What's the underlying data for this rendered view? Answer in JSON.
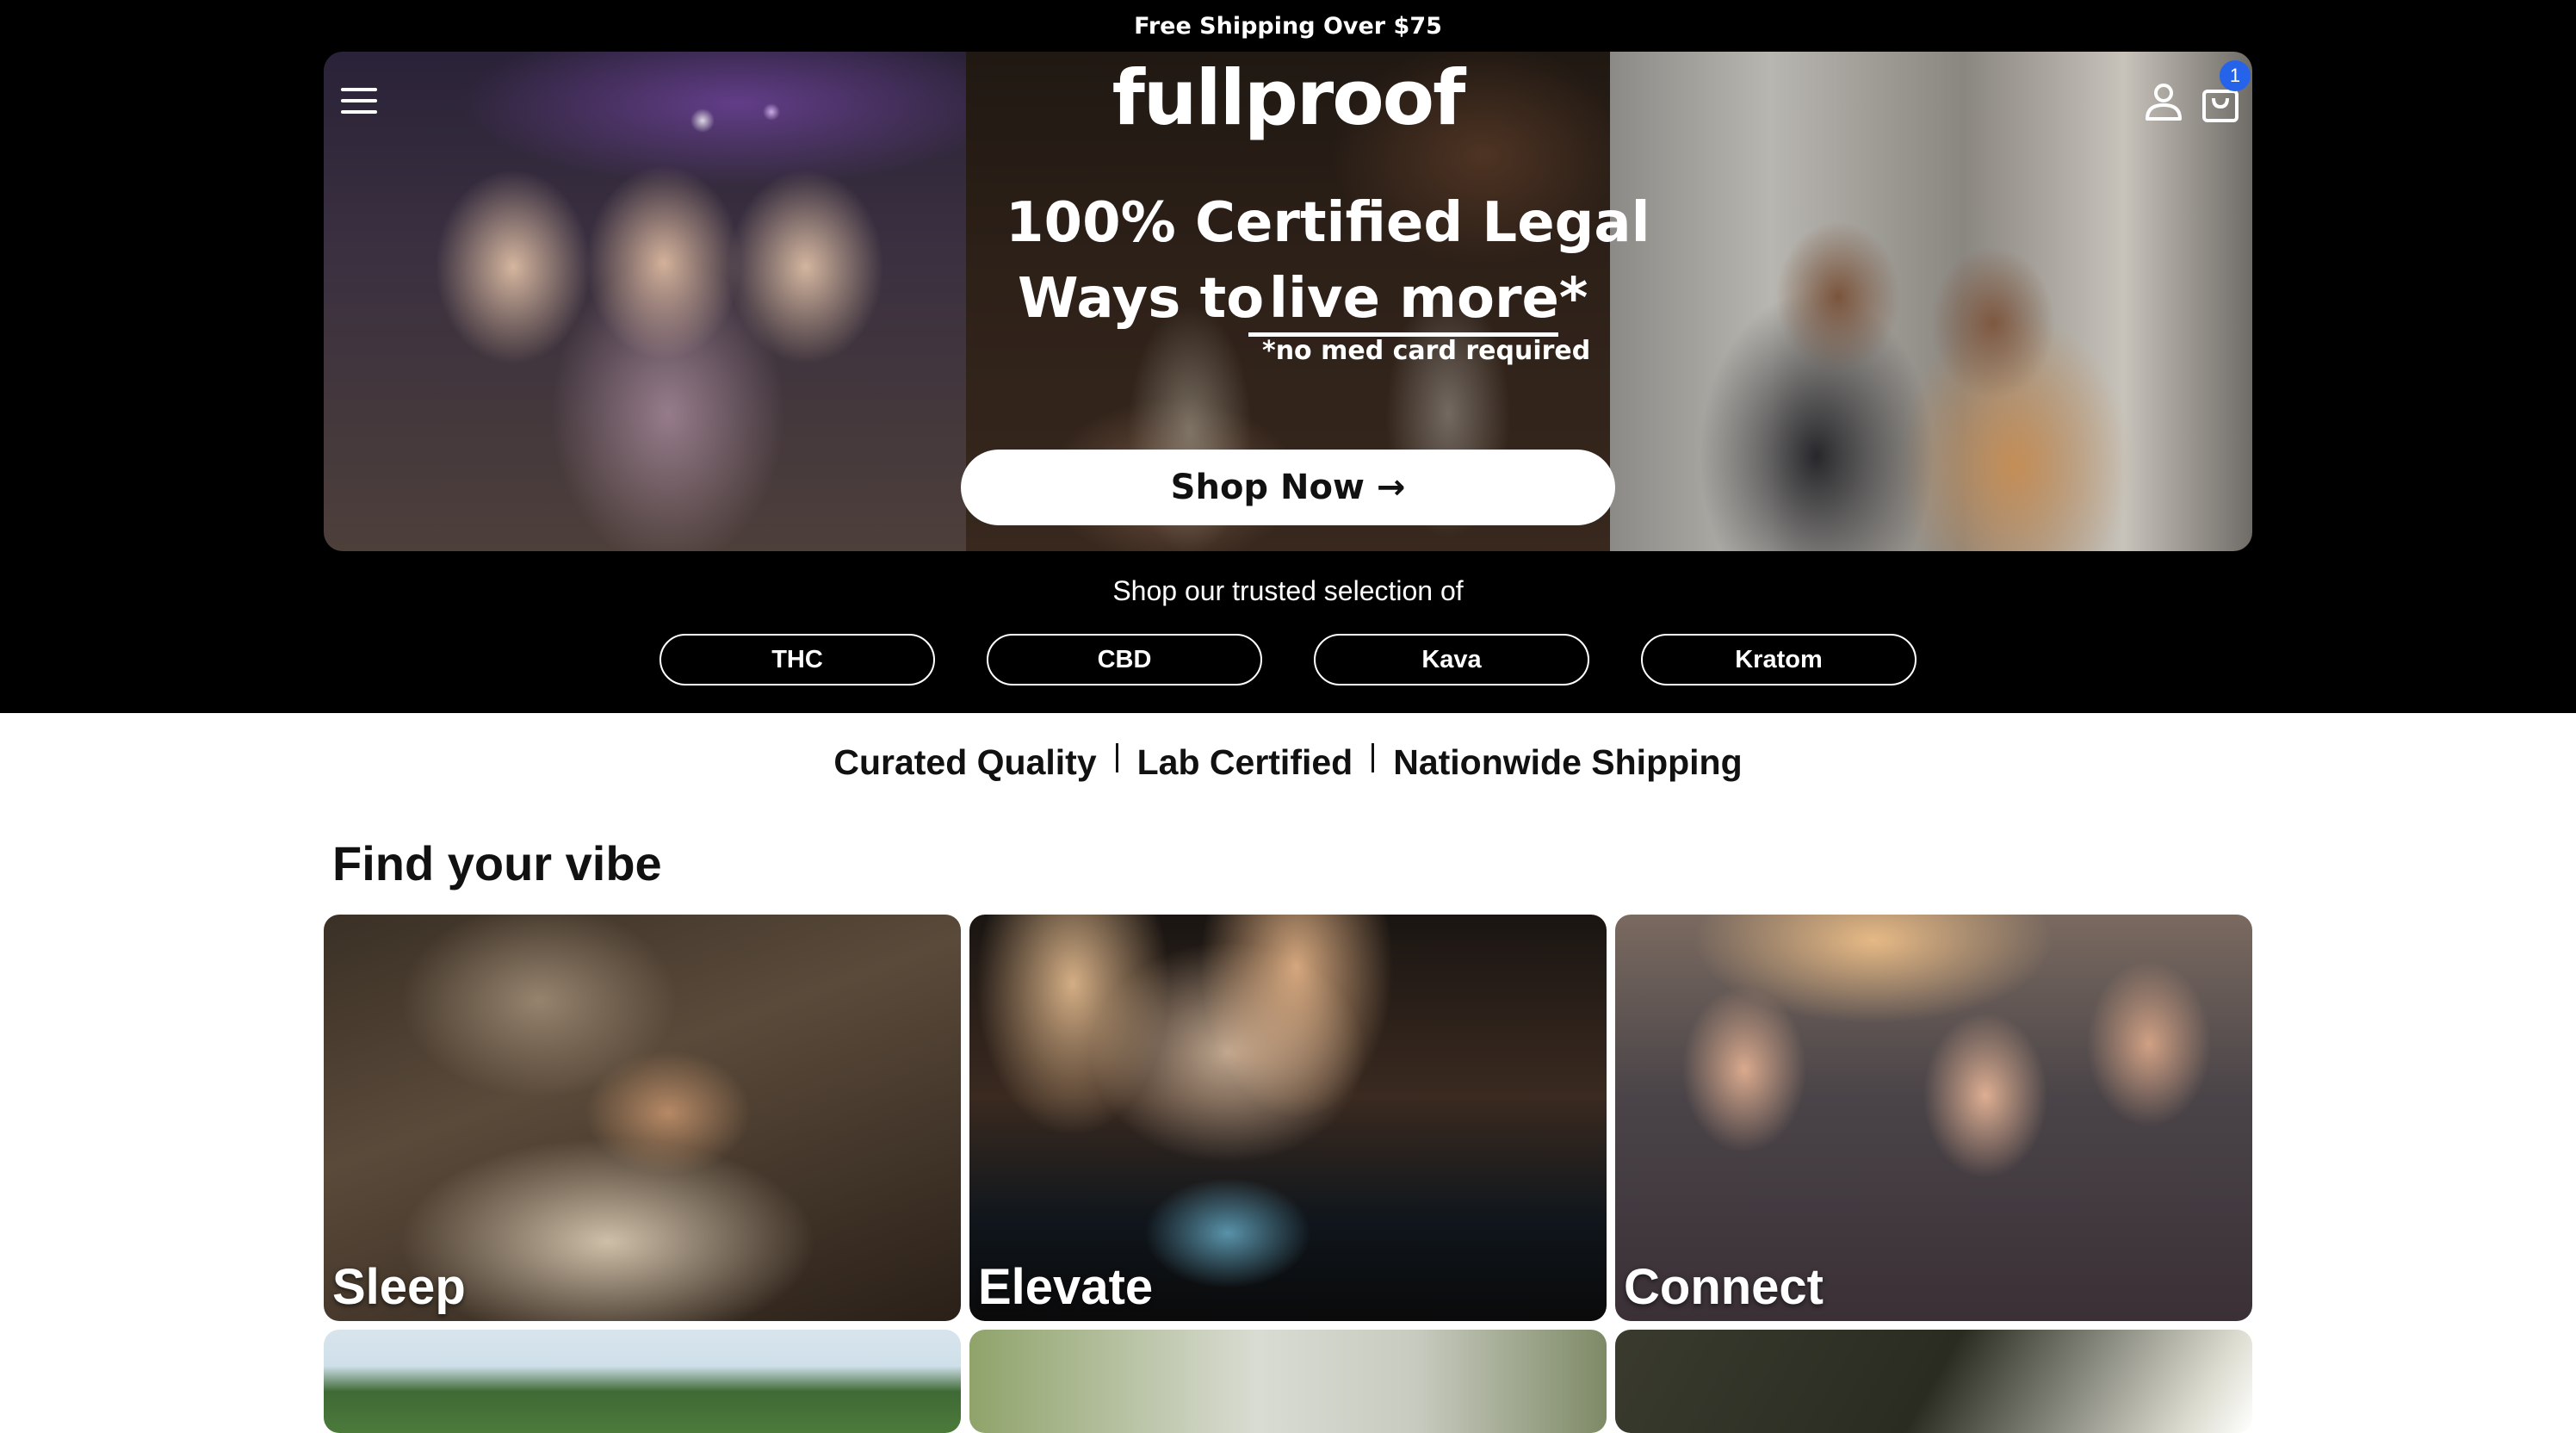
{
  "announcement": {
    "text": "Free Shipping Over $75"
  },
  "header": {
    "logo": "fullproof",
    "menu_icon": "hamburger-menu-icon",
    "account_icon": "user-icon",
    "cart_icon": "shopping-bag-icon",
    "cart_count": "1"
  },
  "hero": {
    "headline_line1": "100% Certified Legal",
    "headline_line2_prefix": "Ways to",
    "headline_highlight": "live more*",
    "footnote": "*no med card required",
    "cta": "Shop Now →"
  },
  "selection": {
    "intro": "Shop our trusted selection of",
    "categories": [
      "THC",
      "CBD",
      "Kava",
      "Kratom"
    ]
  },
  "features": [
    "Curated Quality",
    "Lab Certified",
    "Nationwide Shipping"
  ],
  "vibes": {
    "title": "Find your vibe",
    "items": [
      {
        "label": "Sleep"
      },
      {
        "label": "Elevate"
      },
      {
        "label": "Connect"
      }
    ]
  },
  "colors": {
    "background_dark": "#000000",
    "cart_badge": "#2563eb",
    "button_bg": "#ffffff"
  }
}
